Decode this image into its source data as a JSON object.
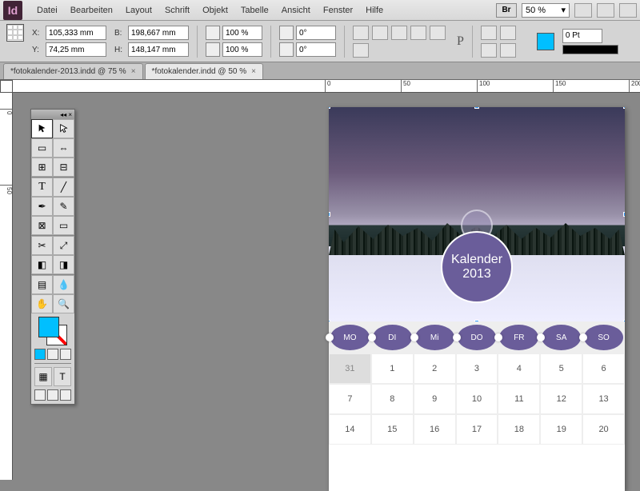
{
  "app": {
    "logo": "Id"
  },
  "menu": [
    "Datei",
    "Bearbeiten",
    "Layout",
    "Schrift",
    "Objekt",
    "Tabelle",
    "Ansicht",
    "Fenster",
    "Hilfe"
  ],
  "menu_right": {
    "bridge": "Br",
    "zoom": "50 %"
  },
  "control": {
    "x": "105,333 mm",
    "y": "74,25 mm",
    "w": "198,667 mm",
    "h": "148,147 mm",
    "sx": "100 %",
    "sy": "100 %",
    "rot": "0°",
    "shear": "0°",
    "stroke_pt": "0 Pt"
  },
  "tabs": [
    {
      "label": "*fotokalender-2013.indd @ 75 %",
      "active": false
    },
    {
      "label": "*fotokalender.indd @ 50 %",
      "active": true
    }
  ],
  "ruler_h": [
    "0",
    "50",
    "100",
    "150",
    "200"
  ],
  "ruler_v": [
    "0",
    "50"
  ],
  "doc": {
    "badge_title": "Kalender",
    "badge_year": "2013",
    "days": [
      "MO",
      "DI",
      "Mi",
      "DO",
      "FR",
      "SA",
      "SO"
    ],
    "rows": [
      [
        "31",
        "1",
        "2",
        "3",
        "4",
        "5",
        "6"
      ],
      [
        "7",
        "8",
        "9",
        "10",
        "11",
        "12",
        "13"
      ],
      [
        "14",
        "15",
        "16",
        "17",
        "18",
        "19",
        "20"
      ]
    ],
    "prev_flags": [
      [
        true,
        false,
        false,
        false,
        false,
        false,
        false
      ],
      [
        false,
        false,
        false,
        false,
        false,
        false,
        false
      ],
      [
        false,
        false,
        false,
        false,
        false,
        false,
        false
      ]
    ]
  },
  "labels": {
    "X": "X:",
    "Y": "Y:",
    "B": "B:",
    "H": "H:"
  },
  "colors": {
    "accent": "#00BFFF",
    "badge": "#6a5d9a"
  }
}
